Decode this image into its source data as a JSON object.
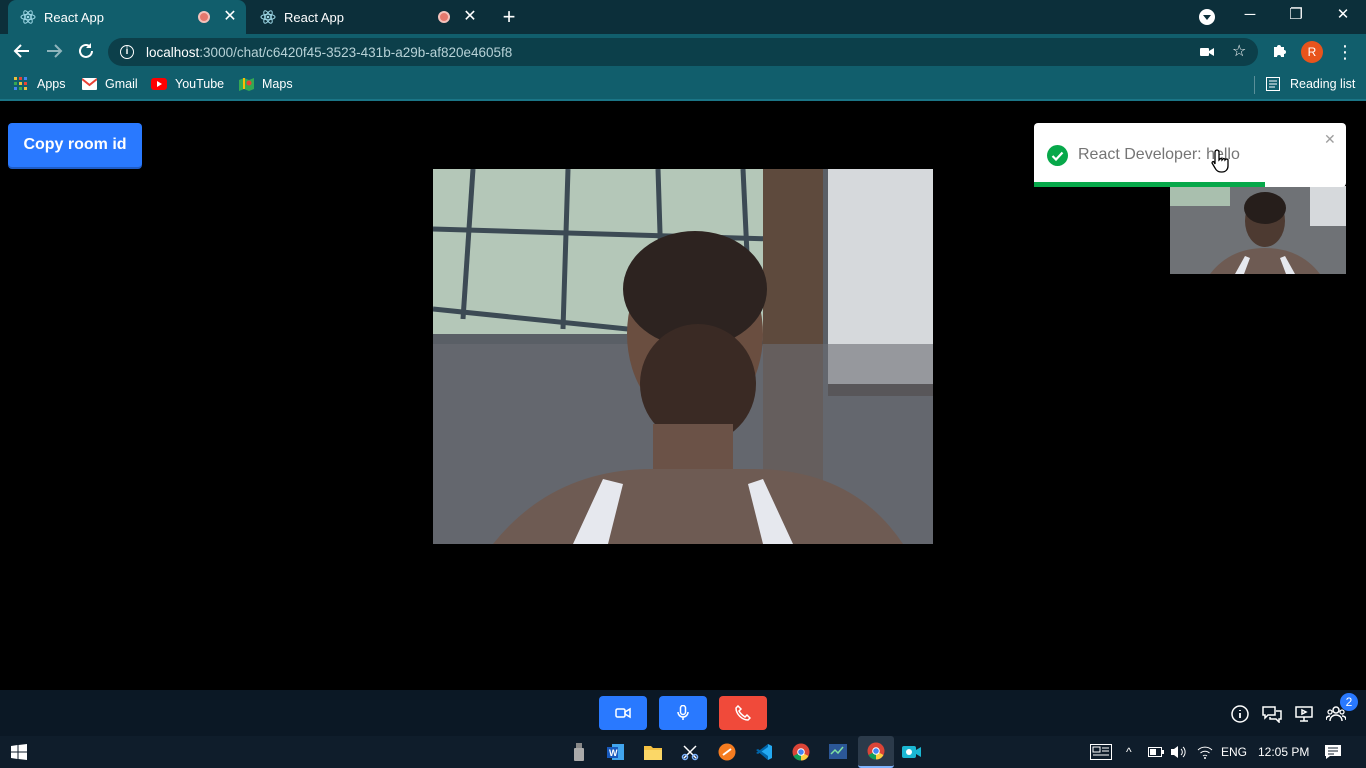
{
  "browser": {
    "tabs": [
      {
        "title": "React App",
        "active": true
      },
      {
        "title": "React App",
        "active": false
      }
    ],
    "url": {
      "host": "localhost",
      "path": ":3000/chat/c6420f45-3523-431b-a29b-af820e4605f8"
    },
    "profile_initial": "R",
    "bookmarks": [
      {
        "label": "Apps",
        "icon": "apps-grid-icon"
      },
      {
        "label": "Gmail",
        "icon": "gmail-icon"
      },
      {
        "label": "YouTube",
        "icon": "youtube-icon"
      },
      {
        "label": "Maps",
        "icon": "maps-icon"
      }
    ],
    "reading_list": "Reading list"
  },
  "page": {
    "copy_button": "Copy room id",
    "toast": {
      "message": "React Developer: hello",
      "progress": 0.74
    }
  },
  "controls": {
    "buttons": [
      {
        "name": "camera",
        "color": "#2979ff"
      },
      {
        "name": "microphone",
        "color": "#2979ff"
      },
      {
        "name": "end-call",
        "color": "#f04a3a"
      }
    ],
    "participants_badge": "2"
  },
  "taskbar": {
    "language": "ENG",
    "time": "12:05 PM"
  },
  "colors": {
    "accent": "#2979ff",
    "danger": "#f04a3a",
    "success": "#07a84a",
    "chrome_dark": "#0c2f3a",
    "chrome": "#115e6c"
  }
}
